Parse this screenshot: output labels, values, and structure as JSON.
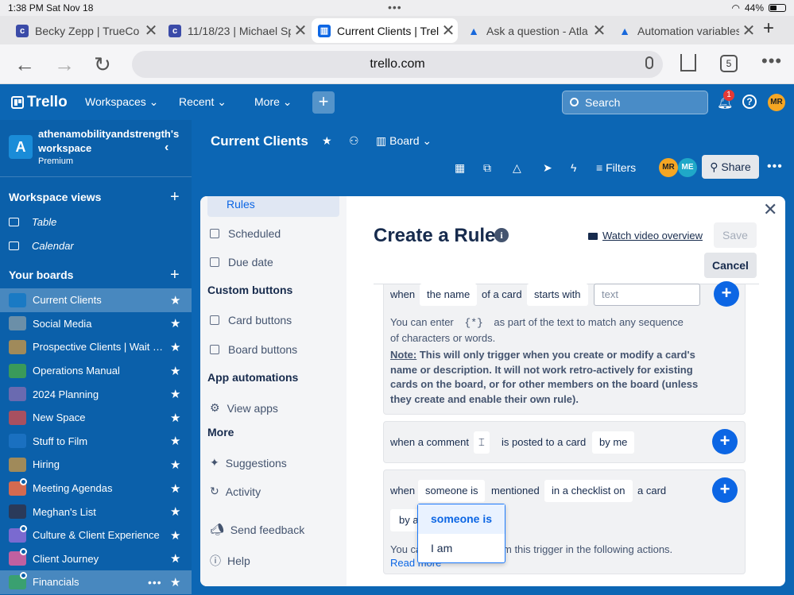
{
  "status_bar": {
    "time": "1:38 PM",
    "date": "Sat Nov 18",
    "battery": "44%"
  },
  "browser": {
    "tabs": [
      {
        "label": "Becky Zepp | TrueCo",
        "icon_color": "#3b4ba8",
        "active": false
      },
      {
        "label": "11/18/23 | Michael Sp",
        "icon_color": "#3b4ba8",
        "active": false
      },
      {
        "label": "Current Clients | Trello",
        "icon_color": "#0c66e4",
        "active": true
      },
      {
        "label": "Ask a question - Atla",
        "icon_color": "#1868db",
        "active": false
      },
      {
        "label": "Automation variables",
        "icon_color": "#1868db",
        "active": false
      }
    ],
    "url": "trello.com",
    "tab_count": "5"
  },
  "trello_bar": {
    "logo": "Trello",
    "menus": [
      "Workspaces",
      "Recent",
      "More"
    ],
    "search_placeholder": "Search",
    "notification_count": "1",
    "avatar": "MR"
  },
  "sidebar": {
    "workspace_initial": "A",
    "workspace_name": "athenamobilityandstrength's workspace",
    "workspace_plan": "Premium",
    "workspace_views_title": "Workspace views",
    "views": [
      "Table",
      "Calendar"
    ],
    "boards_title": "Your boards",
    "boards": [
      {
        "name": "Current Clients",
        "color": "#1a7ac4",
        "selected": true
      },
      {
        "name": "Social Media",
        "color": "#6b8fa8"
      },
      {
        "name": "Prospective Clients | Wait List",
        "color": "#a08a5a"
      },
      {
        "name": "Operations Manual",
        "color": "#3a9a5a"
      },
      {
        "name": "2024 Planning",
        "color": "#6a6ab0"
      },
      {
        "name": "New Space",
        "color": "#a85060"
      },
      {
        "name": "Stuff to Film",
        "color": "#1a70c0"
      },
      {
        "name": "Hiring",
        "color": "#a08a5a"
      },
      {
        "name": "Meeting Agendas",
        "color": "#d46a50",
        "dot": true
      },
      {
        "name": "Meghan's List",
        "color": "#2a3a5a"
      },
      {
        "name": "Culture & Client Experience",
        "color": "#7a6ad0",
        "dot": true
      },
      {
        "name": "Client Journey",
        "color": "#c060a0",
        "dot": true
      },
      {
        "name": "Financials",
        "color": "#3aa070",
        "dot": true,
        "hover": true
      }
    ]
  },
  "board_header": {
    "title": "Current Clients",
    "view": "Board",
    "filters": "Filters",
    "members": [
      "MR",
      "ME"
    ],
    "share": "Share"
  },
  "modal": {
    "nav": {
      "active": "Rules",
      "items_top": [
        "Scheduled",
        "Due date"
      ],
      "custom_buttons_title": "Custom buttons",
      "custom_buttons": [
        "Card buttons",
        "Board buttons"
      ],
      "app_automations_title": "App automations",
      "app_automations": [
        "View apps"
      ],
      "more_title": "More",
      "more": [
        "Suggestions",
        "Activity",
        "Send feedback",
        "Help"
      ]
    },
    "title": "Create a Rule",
    "watch_video": "Watch video overview",
    "save": "Save",
    "cancel": "Cancel",
    "trigger1": {
      "when": "when",
      "field": "the name",
      "of_a_card": "of a card",
      "op": "starts with",
      "input_placeholder": "text",
      "hint1": "You can enter",
      "hint_code": "{*}",
      "hint2": "as part of the text to match any sequence",
      "hint3": "of characters or words.",
      "note_label": "Note:",
      "note_text": "This will only trigger when you create or modify a card's name or description. It will not work retro-actively for existing cards on the board, or for other members on the board (unless they create and enable their own rule)."
    },
    "trigger2": {
      "prefix": "when a comment",
      "mid": "is posted to a card",
      "by": "by me"
    },
    "trigger3": {
      "when": "when",
      "who": "someone is",
      "mentioned": "mentioned",
      "where": "in a checklist on",
      "a_card": "a card",
      "by_a": "by a",
      "hint_start": "You ca",
      "hint_end": "m this trigger in the following actions.",
      "read_more": "Read more",
      "dropdown_options": [
        "someone is",
        "I am"
      ]
    }
  }
}
